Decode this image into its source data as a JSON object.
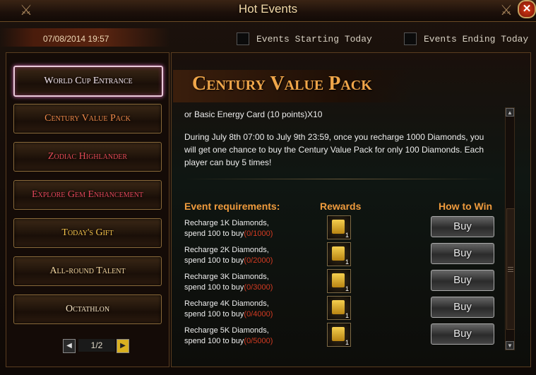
{
  "window": {
    "title": "Hot Events",
    "close_label": "✕"
  },
  "topbar": {
    "date": "07/08/2014 19:57",
    "filters": [
      "Events Starting Today",
      "Events Ending Today"
    ]
  },
  "sidebar": {
    "items": [
      {
        "label": "World Cup Entrance",
        "color": "#f3e6f0",
        "selected": true
      },
      {
        "label": "Century Value Pack",
        "color": "#f08a4a",
        "selected": false
      },
      {
        "label": "Zodiac Highlander",
        "color": "#e24a55",
        "selected": false
      },
      {
        "label": "Explore Gem Enhancement",
        "color": "#e2465a",
        "selected": false
      },
      {
        "label": "Today's Gift",
        "color": "#f2c14a",
        "selected": false
      },
      {
        "label": "All-round Talent",
        "color": "#f4d7a0",
        "selected": false
      },
      {
        "label": "Octathlon",
        "color": "#f6e3c2",
        "selected": false
      }
    ],
    "pager": {
      "prev": "◀",
      "next": "▶",
      "page": "1/2"
    }
  },
  "event": {
    "title": "Century Value Pack",
    "partial_line": "or Basic Energy Card (10 points)X10",
    "description_line1": "During July 8th 07:00 to July 9th 23:59, once you recharge 1000 Diamonds, you",
    "description_line2": "will get one chance to buy the Century Value Pack for only 100 Diamonds. Each",
    "description_line3": "player can buy 5 times!",
    "headers": {
      "requirements": "Event requirements:",
      "rewards": "Rewards",
      "how_to_win": "How to Win"
    },
    "rows": [
      {
        "line1": "Recharge 1K Diamonds,",
        "line2": "spend 100 to buy",
        "progress": "(0/1000)",
        "reward_count": "1",
        "button": "Buy"
      },
      {
        "line1": "Recharge 2K Diamonds,",
        "line2": "spend 100 to buy",
        "progress": "(0/2000)",
        "reward_count": "1",
        "button": "Buy"
      },
      {
        "line1": "Recharge 3K Diamonds,",
        "line2": "spend 100 to buy",
        "progress": "(0/3000)",
        "reward_count": "1",
        "button": "Buy"
      },
      {
        "line1": "Recharge 4K Diamonds,",
        "line2": "spend 100 to buy",
        "progress": "(0/4000)",
        "reward_count": "1",
        "button": "Buy"
      },
      {
        "line1": "Recharge 5K Diamonds,",
        "line2": "spend 100 to buy",
        "progress": "(0/5000)",
        "reward_count": "1",
        "button": "Buy"
      }
    ]
  },
  "scrollbar": {
    "up": "▲",
    "down": "▼"
  }
}
